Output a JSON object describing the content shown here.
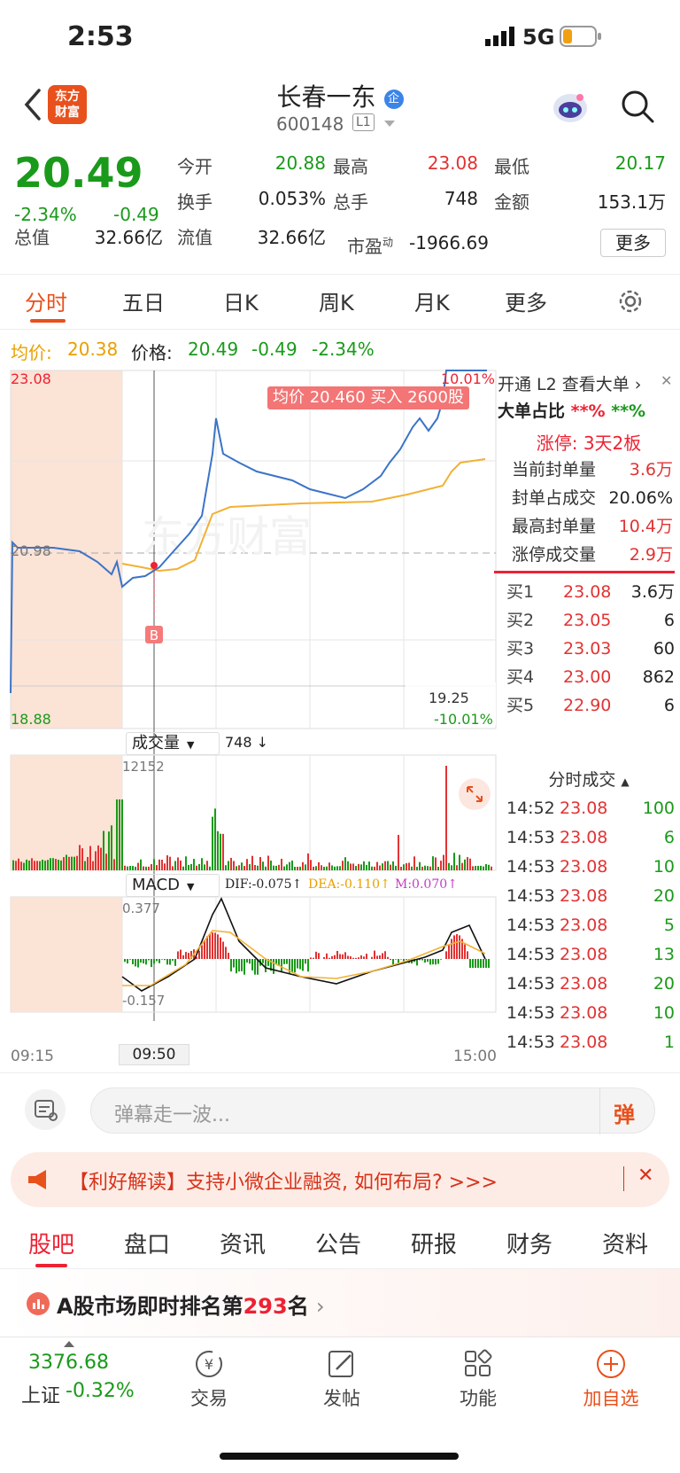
{
  "status": {
    "time": "2:53",
    "network": "5G"
  },
  "header": {
    "back_label": "‹",
    "logo_text": "东方财富",
    "stock_name": "长春一东",
    "badge": "企",
    "stock_code": "600148",
    "level": "L1"
  },
  "quote": {
    "price": "20.49",
    "change_pct": "-2.34%",
    "change": "-0.49",
    "fields": [
      {
        "label": "今开",
        "value": "20.88",
        "color": "green"
      },
      {
        "label": "最高",
        "value": "23.08",
        "color": "red"
      },
      {
        "label": "最低",
        "value": "20.17",
        "color": "green"
      },
      {
        "label": "换手",
        "value": "0.053%",
        "color": "dark"
      },
      {
        "label": "总手",
        "value": "748",
        "color": "dark"
      },
      {
        "label": "金额",
        "value": "153.1万",
        "color": "dark"
      },
      {
        "label": "总值",
        "value": "32.66亿",
        "color": "dark"
      },
      {
        "label": "流值",
        "value": "32.66亿",
        "color": "dark"
      }
    ],
    "pe_label": "市盈",
    "pe_sup": "动",
    "pe_value": "-1966.69",
    "more_button": "更多"
  },
  "tabs": [
    "分时",
    "五日",
    "日K",
    "周K",
    "月K",
    "更多"
  ],
  "avg_line": {
    "avg_label": "均价:",
    "avg_value": "20.38",
    "price_label": "价格:",
    "price_value": "20.49",
    "change": "-0.49",
    "change_pct": "-2.34%"
  },
  "chart": {
    "y_top": "23.08",
    "y_mid": "20.98",
    "y_low": "19.25",
    "y_bottom": "18.88",
    "pct_top": "10.01%",
    "pct_bottom": "-10.01%",
    "trade_tag": "均价 20.460 买入 2600股",
    "buy_marker": "B",
    "watermark": "东方财富",
    "volume_label": "成交量",
    "volume_value": "748",
    "volume_arrow": "↓",
    "volume_max": "12152",
    "macd_label": "MACD",
    "dif": "DIF:-0.075",
    "dea": "DEA:-0.110",
    "m": "M:0.070",
    "macd_top": "0.377",
    "macd_bottom": "-0.157",
    "time_start": "09:15",
    "time_cursor": "09:50",
    "time_end": "15:00"
  },
  "side": {
    "l2_text": "开通 L2 查看大单",
    "big_order_label": "大单占比",
    "big_order_v1": "**%",
    "big_order_v2": "**%",
    "limit_up": "涨停: 3天2板",
    "seal_rows": [
      {
        "label": "当前封单量",
        "value": "3.6万",
        "color": "red"
      },
      {
        "label": "封单占成交",
        "value": "20.06%",
        "color": "dark"
      },
      {
        "label": "最高封单量",
        "value": "10.4万",
        "color": "red"
      },
      {
        "label": "涨停成交量",
        "value": "2.9万",
        "color": "red"
      }
    ],
    "bids": [
      {
        "label": "买1",
        "price": "23.08",
        "vol": "3.6万"
      },
      {
        "label": "买2",
        "price": "23.05",
        "vol": "6"
      },
      {
        "label": "买3",
        "price": "23.03",
        "vol": "60"
      },
      {
        "label": "买4",
        "price": "23.00",
        "vol": "862"
      },
      {
        "label": "买5",
        "price": "22.90",
        "vol": "6"
      }
    ],
    "ticks_title": "分时成交",
    "ticks": [
      {
        "time": "14:52",
        "price": "23.08",
        "vol": "100"
      },
      {
        "time": "14:53",
        "price": "23.08",
        "vol": "6"
      },
      {
        "time": "14:53",
        "price": "23.08",
        "vol": "10"
      },
      {
        "time": "14:53",
        "price": "23.08",
        "vol": "20"
      },
      {
        "time": "14:53",
        "price": "23.08",
        "vol": "5"
      },
      {
        "time": "14:53",
        "price": "23.08",
        "vol": "13"
      },
      {
        "time": "14:53",
        "price": "23.08",
        "vol": "20"
      },
      {
        "time": "14:53",
        "price": "23.08",
        "vol": "10"
      },
      {
        "time": "14:53",
        "price": "23.08",
        "vol": "1"
      }
    ]
  },
  "danmu": {
    "placeholder": "弹幕走一波...",
    "button": "弹"
  },
  "banner": {
    "text": "【利好解读】支持小微企业融资, 如何布局? >>>"
  },
  "bottom_tabs": [
    "股吧",
    "盘口",
    "资讯",
    "公告",
    "研报",
    "财务",
    "资料"
  ],
  "rank": {
    "prefix": "A股市场即时排名第",
    "number": "293",
    "suffix": "名"
  },
  "navbar": {
    "index_value": "3376.68",
    "index_name": "上证",
    "index_change": "-0.32%",
    "items": [
      "交易",
      "发帖",
      "功能",
      "加自选"
    ]
  },
  "colors": {
    "red": "#e23333",
    "green": "#1a9a1a",
    "orange": "#e8501c",
    "blue": "#3b74c8",
    "avg": "#f2b134"
  }
}
